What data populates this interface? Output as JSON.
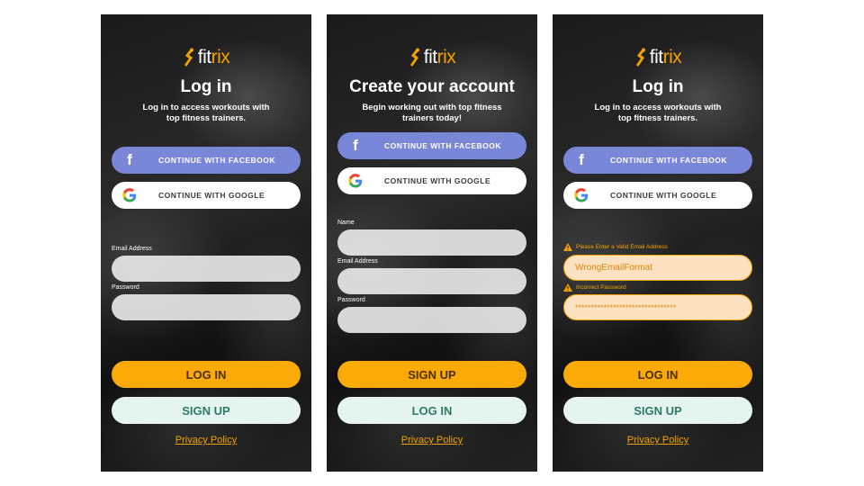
{
  "brand": {
    "prefix": "fit",
    "highlight": "rix",
    "accent": "#f5a300"
  },
  "screens": [
    {
      "title": "Log in",
      "subtitle_1": "Log in to access workouts with",
      "subtitle_2": "top fitness trainers.",
      "facebook_label": "CONTINUE WITH FACEBOOK",
      "google_label": "CONTINUE WITH GOOGLE",
      "email_label": "Email Address",
      "password_label": "Password",
      "primary_label": "LOG IN",
      "secondary_label": "SIGN UP",
      "privacy_label": "Privacy Policy"
    },
    {
      "title": "Create your account",
      "subtitle_1": "Begin working out with top fitness",
      "subtitle_2": "trainers today!",
      "facebook_label": "CONTINUE WITH FACEBOOK",
      "google_label": "CONTINUE WITH GOOGLE",
      "name_label": "Name",
      "email_label": "Email Address",
      "password_label": "Password",
      "primary_label": "SIGN UP",
      "secondary_label": "LOG IN",
      "privacy_label": "Privacy Policy"
    },
    {
      "title": "Log in",
      "subtitle_1": "Log in to access workouts with",
      "subtitle_2": "top fitness trainers.",
      "facebook_label": "CONTINUE WITH FACEBOOK",
      "google_label": "CONTINUE WITH GOOGLE",
      "email_error": "Please Enter a Valid Email Address",
      "email_value": "WrongEmailFormat",
      "password_error": "Incorrect Password",
      "password_value": "********************************",
      "primary_label": "LOG IN",
      "secondary_label": "SIGN UP",
      "privacy_label": "Privacy Policy"
    }
  ]
}
